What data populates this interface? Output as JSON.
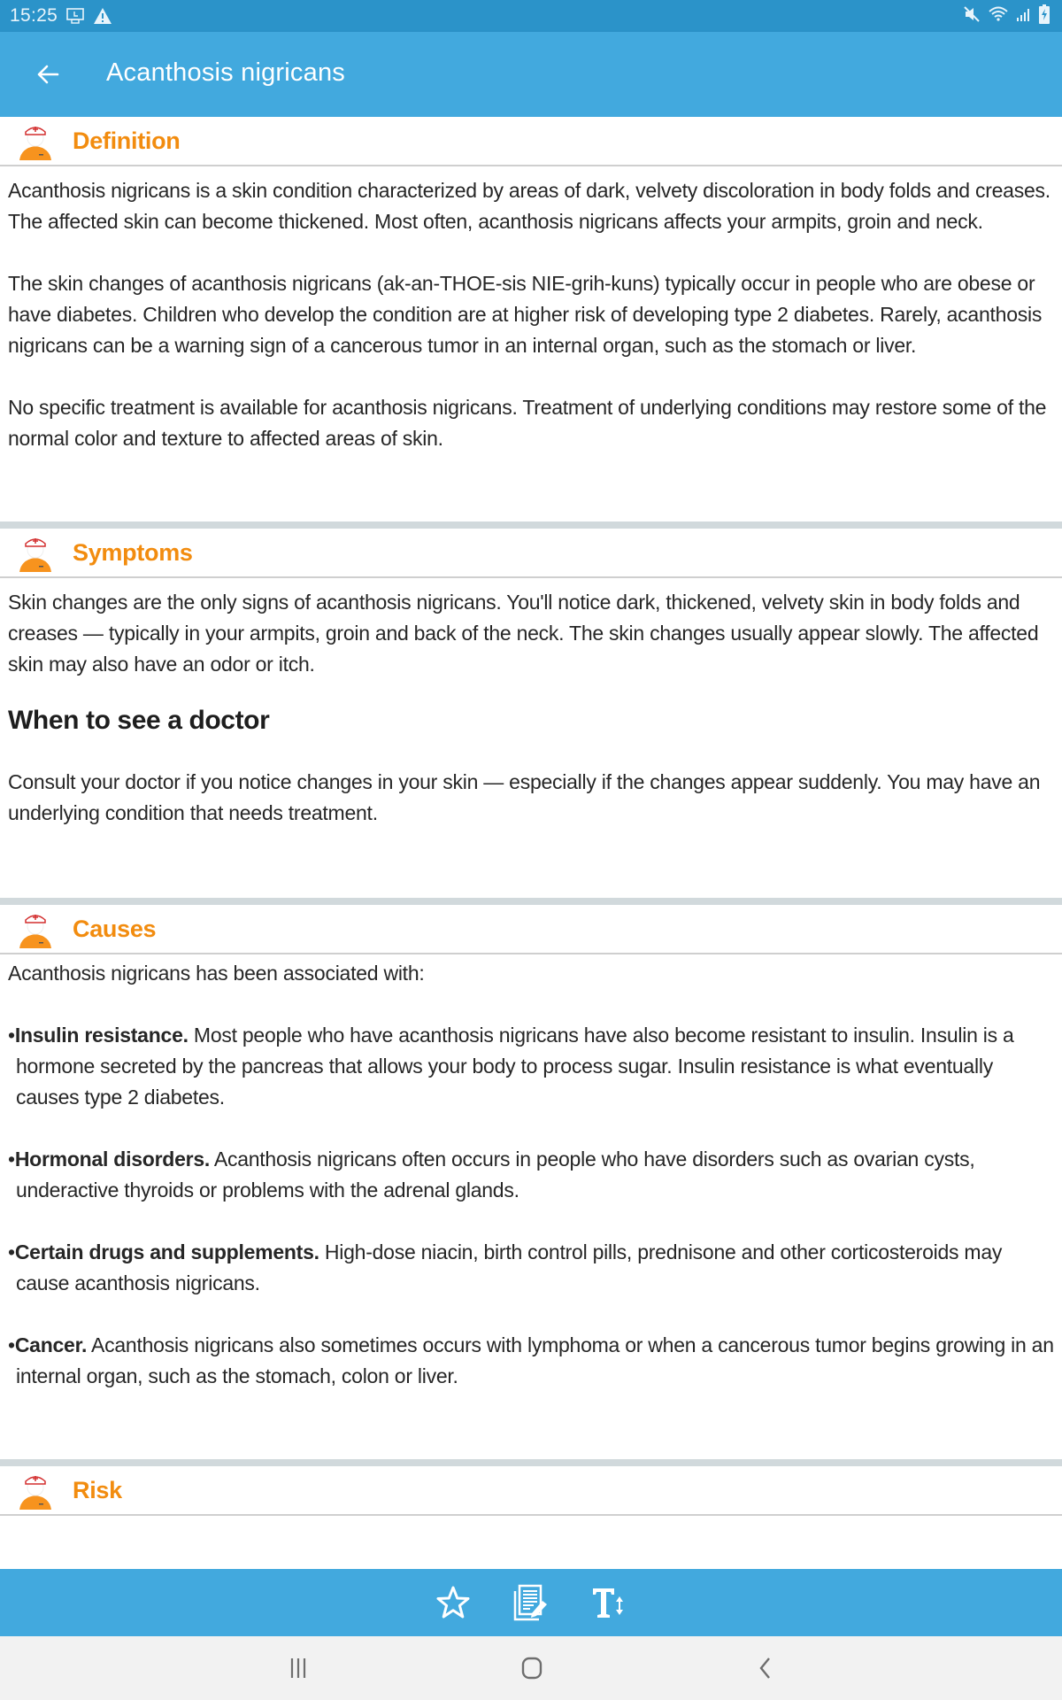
{
  "status_bar": {
    "time": "15:25",
    "left_icons": [
      "screen-time-icon",
      "warning-icon"
    ],
    "right_icons": [
      "mute-icon",
      "wifi-icon",
      "signal-icon",
      "battery-charging-icon"
    ]
  },
  "app_bar": {
    "title": "Acanthosis nigricans",
    "back_icon": "arrow-left-icon"
  },
  "colors": {
    "status_bar": "#2b93c9",
    "app_bar": "#42a9de",
    "section_title": "#f28c0f",
    "separator": "#d1d9dc"
  },
  "sections": {
    "definition": {
      "title": "Definition",
      "paragraphs": [
        "Acanthosis nigricans is a skin condition characterized by areas of dark, velvety discoloration in body folds and creases. The affected skin can become thickened. Most often, acanthosis nigricans affects your armpits, groin and neck.",
        "The skin changes of acanthosis nigricans (ak-an-THOE-sis NIE-grih-kuns) typically occur in people who are obese or have diabetes. Children who develop the condition are at higher risk of developing type 2 diabetes. Rarely, acanthosis nigricans can be a warning sign of a cancerous tumor in an internal organ, such as the stomach or liver.",
        "No specific treatment is available for acanthosis nigricans. Treatment of underlying conditions may restore some of the normal color and texture to affected areas of skin."
      ]
    },
    "symptoms": {
      "title": "Symptoms",
      "paragraphs": [
        "Skin changes are the only signs of acanthosis nigricans. You'll notice dark, thickened, velvety skin in body folds and creases — typically in your armpits, groin and back of the neck. The skin changes usually appear slowly. The affected skin may also have an odor or itch."
      ],
      "subheading": "When to see a doctor",
      "sub_paragraphs": [
        "Consult your doctor if you notice changes in your skin — especially if the changes appear suddenly. You may have an underlying condition that needs treatment."
      ]
    },
    "causes": {
      "title": "Causes",
      "intro": "Acanthosis nigricans has been associated with:",
      "bullets": [
        {
          "lead": "Insulin resistance.",
          "text": " Most people who have acanthosis nigricans have also become resistant to insulin. Insulin is a hormone secreted by the pancreas that allows your body to process sugar. Insulin resistance is what eventually causes type 2 diabetes."
        },
        {
          "lead": "Hormonal disorders.",
          "text": " Acanthosis nigricans often occurs in people who have disorders such as ovarian cysts, underactive thyroids or problems with the adrenal glands."
        },
        {
          "lead": "Certain drugs and supplements.",
          "text": " High-dose niacin, birth control pills, prednisone and other corticosteroids may cause acanthosis nigricans."
        },
        {
          "lead": "Cancer.",
          "text": " Acanthosis nigricans also sometimes occurs with lymphoma or when a cancerous tumor begins growing in an internal organ, such as the stomach, colon or liver."
        }
      ]
    },
    "risk": {
      "title": "Risk"
    }
  },
  "bottom_toolbar": {
    "buttons": [
      "favorite-star-icon",
      "notes-edit-icon",
      "text-size-icon"
    ]
  },
  "nav_bar": {
    "buttons": [
      "recent-apps-icon",
      "home-icon",
      "back-icon"
    ]
  }
}
